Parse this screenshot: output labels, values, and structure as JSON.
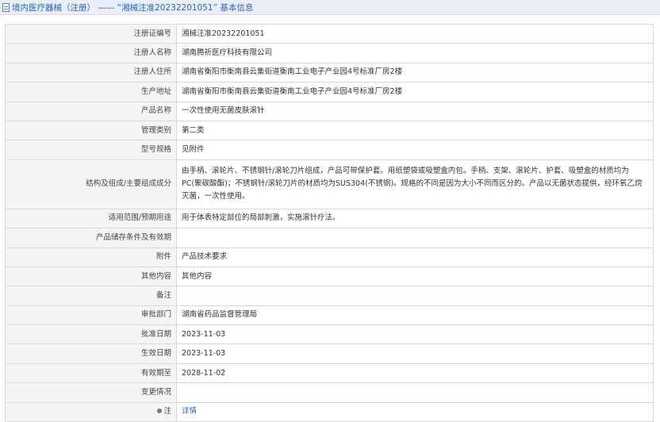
{
  "header": {
    "title": "境内医疗器械（注册） ——  “湘械注准20232201051” 基本信息"
  },
  "rows": [
    {
      "label": "注册证编号",
      "value": "湘械注准20232201051"
    },
    {
      "label": "注册人名称",
      "value": "湖南腾祈医疗科技有限公司"
    },
    {
      "label": "注册人住所",
      "value": "湖南省衡阳市衡南县云集街道衡南工业电子产业园4号标准厂房2楼"
    },
    {
      "label": "生产地址",
      "value": "湖南省衡阳市衡南县云集街道衡南工业电子产业园4号标准厂房2楼"
    },
    {
      "label": "产品名称",
      "value": "一次性使用无菌皮肤滚针"
    },
    {
      "label": "管理类别",
      "value": "第二类"
    },
    {
      "label": "型号规格",
      "value": "见附件"
    },
    {
      "label": "结构及组成/主要组成成分",
      "value": "由手柄、滚轮片、不锈钢针/滚轮刀片组成，产品可带保护套。用纸塑袋或吸塑盒内包。手柄、支架、滚轮片、护套、吸塑盒的材质均为PC(聚碳酸酯)；不锈钢针/滚轮刀片的材质均为SUS304(不锈钢)。规格的不同是因为大小不同而区分的。产品以无菌状态提供，经环氧乙烷灭菌，一次性使用。"
    },
    {
      "label": "适用范围/预期用途",
      "value": "用于体表特定部位的局部刺激，实施滚针疗法。"
    },
    {
      "label": "产品储存条件及有效期",
      "value": ""
    },
    {
      "label": "附件",
      "value": "产品技术要求"
    },
    {
      "label": "其他内容",
      "value": "其他内容"
    },
    {
      "label": "备注",
      "value": ""
    },
    {
      "label": "审批部门",
      "value": "湖南省药品监督管理局"
    },
    {
      "label": "批准日期",
      "value": "2023-11-03"
    },
    {
      "label": "生效日期",
      "value": "2023-11-03"
    },
    {
      "label": "有效期至",
      "value": "2028-11-02"
    },
    {
      "label": "变更情况",
      "value": ""
    },
    {
      "label": "注",
      "value": "详情"
    }
  ]
}
